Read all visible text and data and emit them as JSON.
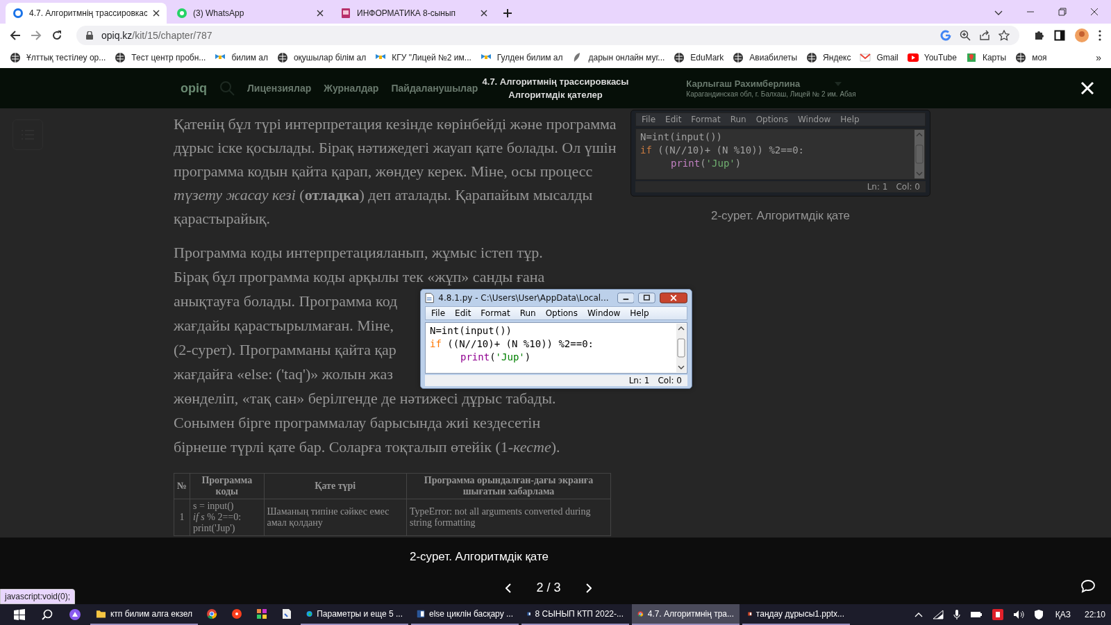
{
  "browser": {
    "tabs": [
      {
        "title": "4.7. Алгоритмнің трассировкас",
        "selected": true
      },
      {
        "title": "(3) WhatsApp",
        "selected": false
      },
      {
        "title": "ИНФОРМАТИКА 8-сынып",
        "selected": false
      }
    ],
    "address": {
      "host": "opiq.kz",
      "path": "/kit/15/chapter/787"
    },
    "bookmarks": [
      {
        "label": "Ұлттық тестілеу ор..."
      },
      {
        "label": "Тест центр пробн..."
      },
      {
        "label": "билим ал"
      },
      {
        "label": "оқушылар білім ал"
      },
      {
        "label": "КГУ \"Лицей №2 им..."
      },
      {
        "label": "Гулден билим ал"
      },
      {
        "label": "дарын онлайн муг..."
      },
      {
        "label": "EduMark"
      },
      {
        "label": "Авиабилеты"
      },
      {
        "label": "Яндекс"
      },
      {
        "label": "Gmail"
      },
      {
        "label": "YouTube"
      },
      {
        "label": "Карты"
      },
      {
        "label": "моя"
      }
    ],
    "more": "»"
  },
  "site_header": {
    "logo": "opiq",
    "nav": [
      "Лицензиялар",
      "Журналдар",
      "Пайдаланушылар"
    ],
    "title": "4.7. Алгоритмнің трассировкасы",
    "subtitle": "Алгоритмдік қателер",
    "user_name": "Карлыгаш Рахимберлина",
    "user_school": "Карагандинская обл, г. Балхаш, Лицей № 2 им. Абая"
  },
  "article": {
    "paragraph_1": "Қатенің бұл түрі интерпретация кезінде көрінбейді және программа дұрыс іске қосылады. Бірақ нәтижедегі жауап қате болады. Ол үшін программа кодын қайта қарап, жөндеу керек. Міне, осы процесс *түзету жасау кезі* (**отладка**) деп аталады. Қарапайым мысалды қарастырайық.",
    "paragraph_2_lines": [
      "Программа коды интерпретацияланып, жұмыс істеп тұр.",
      "Бірақ бұл программа коды арқылы тек «жұп» санды ғана",
      "анықтауға болады. Программа код",
      "жағдайы қарастырылмаған. Міне,",
      "(2-сурет). Программаны қайта қар",
      "жағдайға «else: ('taq')» жолын жаз",
      "жөнделіп, «тақ сан» берілгенде де нәтижесі дұрыс табады.",
      "Сонымен бірге программалау барысында жиі кездесетін",
      "бірнеше түрлі қате бар. Соларға тоқталып өтейік (1-*кесте*)."
    ],
    "table": {
      "columns": [
        "№",
        "Программа коды",
        "Қате түрі",
        "Программа орындалған-дағы экранға шығатын хабарлама"
      ],
      "rows": [
        {
          "cells": [
            "1",
            "s = input()\n*if s* % 2==0:\nprint('Jup')",
            "Шаманың типіне сәйкес емес амал қолдану",
            "TypeError: not all arguments converted during string formatting"
          ]
        }
      ]
    },
    "figure": {
      "window": {
        "menu": [
          "File",
          "Edit",
          "Format",
          "Run",
          "Options",
          "Window",
          "Help"
        ],
        "code": [
          {
            "indent": false,
            "tokens": [
              {
                "kind": "plain",
                "text": "N=int(input())"
              }
            ]
          },
          {
            "indent": false,
            "tokens": [
              {
                "kind": "keyword",
                "text": "if"
              },
              {
                "kind": "plain",
                "text": " ((N//10)+ (N %10)) %2==0:"
              }
            ]
          },
          {
            "indent": true,
            "tokens": [
              {
                "kind": "builtin",
                "text": "print"
              },
              {
                "kind": "plain",
                "text": "("
              },
              {
                "kind": "string",
                "text": "'Jup'"
              },
              {
                "kind": "plain",
                "text": ")"
              }
            ]
          }
        ],
        "line_status": "Ln: 1",
        "col_status": "Col: 0"
      },
      "caption": "2-сурет. Алгоритмдік қате"
    }
  },
  "lightbox": {
    "window": {
      "title": "4.8.1.py - C:\\Users\\User\\AppData\\Local...",
      "menu": [
        "File",
        "Edit",
        "Format",
        "Run",
        "Options",
        "Window",
        "Help"
      ],
      "code": [
        {
          "indent": false,
          "tokens": [
            {
              "kind": "plain",
              "text": "N=int(input())"
            }
          ]
        },
        {
          "indent": false,
          "tokens": [
            {
              "kind": "keyword",
              "text": "if"
            },
            {
              "kind": "plain",
              "text": " ((N//10)+ (N %10)) %2==0:"
            }
          ]
        },
        {
          "indent": true,
          "tokens": [
            {
              "kind": "builtin",
              "text": "print"
            },
            {
              "kind": "plain",
              "text": "("
            },
            {
              "kind": "string",
              "text": "'Jup'"
            },
            {
              "kind": "plain",
              "text": ")"
            }
          ]
        }
      ],
      "line_status": "Ln: 1",
      "col_status": "Col: 0"
    },
    "caption": "2-сурет. Алгоритмдік қате",
    "counter": "2 / 3"
  },
  "status_link": "javascript:void(0);",
  "taskbar": {
    "items": [
      {
        "label": "ктп билим алга екзел",
        "active": false
      },
      {
        "active": false
      },
      {
        "active": false
      },
      {
        "active": false
      },
      {
        "active": false
      },
      {
        "label": "Параметры и еще 5 ...",
        "active": false
      },
      {
        "label": "else циклін басқару ...",
        "active": false
      },
      {
        "label": "8 СЫНЫП КТП 2022-...",
        "active": false
      },
      {
        "label": "4.7. Алгоритмнің тра...",
        "active": true
      },
      {
        "label": "таңдау дұрысы1.pptx...",
        "active": false
      }
    ],
    "language": "ҚАЗ",
    "time": "22:10"
  }
}
